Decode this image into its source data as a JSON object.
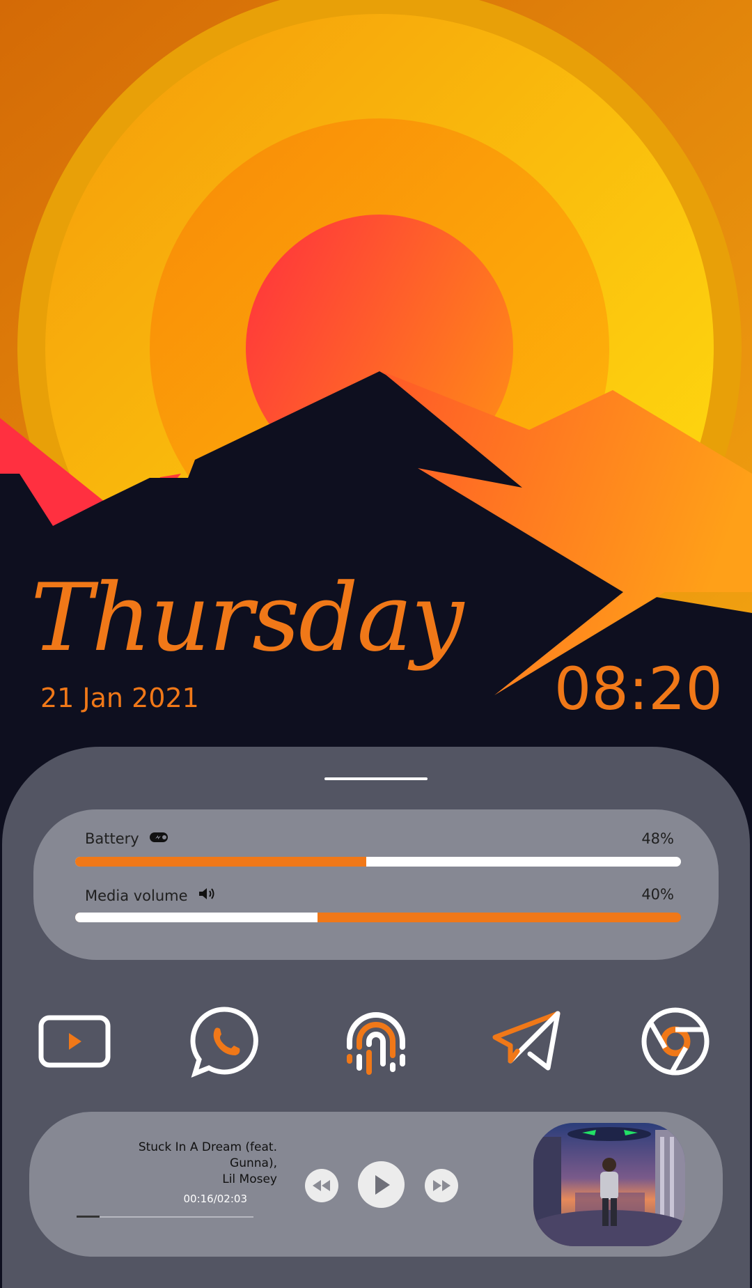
{
  "lockscreen": {
    "day": "Thursday",
    "date": "21 Jan 2021",
    "time": "08:20",
    "accent_color": "#f07818"
  },
  "stats": {
    "battery": {
      "label": "Battery",
      "value_text": "48%",
      "level": 0.48,
      "icon": "battery-charging-icon"
    },
    "volume": {
      "label": "Media volume",
      "value_text": "40%",
      "level": 0.4,
      "icon": "speaker-icon"
    }
  },
  "apps": [
    {
      "name": "youtube",
      "icon": "youtube-icon"
    },
    {
      "name": "whatsapp",
      "icon": "whatsapp-icon"
    },
    {
      "name": "fingerprint",
      "icon": "fingerprint-icon"
    },
    {
      "name": "telegram",
      "icon": "paper-plane-icon"
    },
    {
      "name": "chrome",
      "icon": "chrome-icon"
    }
  ],
  "player": {
    "title_line1": "Stuck In A Dream (feat.",
    "title_line2": "Gunna),",
    "artist": "Lil Mosey",
    "time": "00:16/02:03",
    "progress": 0.13,
    "controls": [
      "rewind-icon",
      "play-icon",
      "fast-forward-icon"
    ]
  }
}
